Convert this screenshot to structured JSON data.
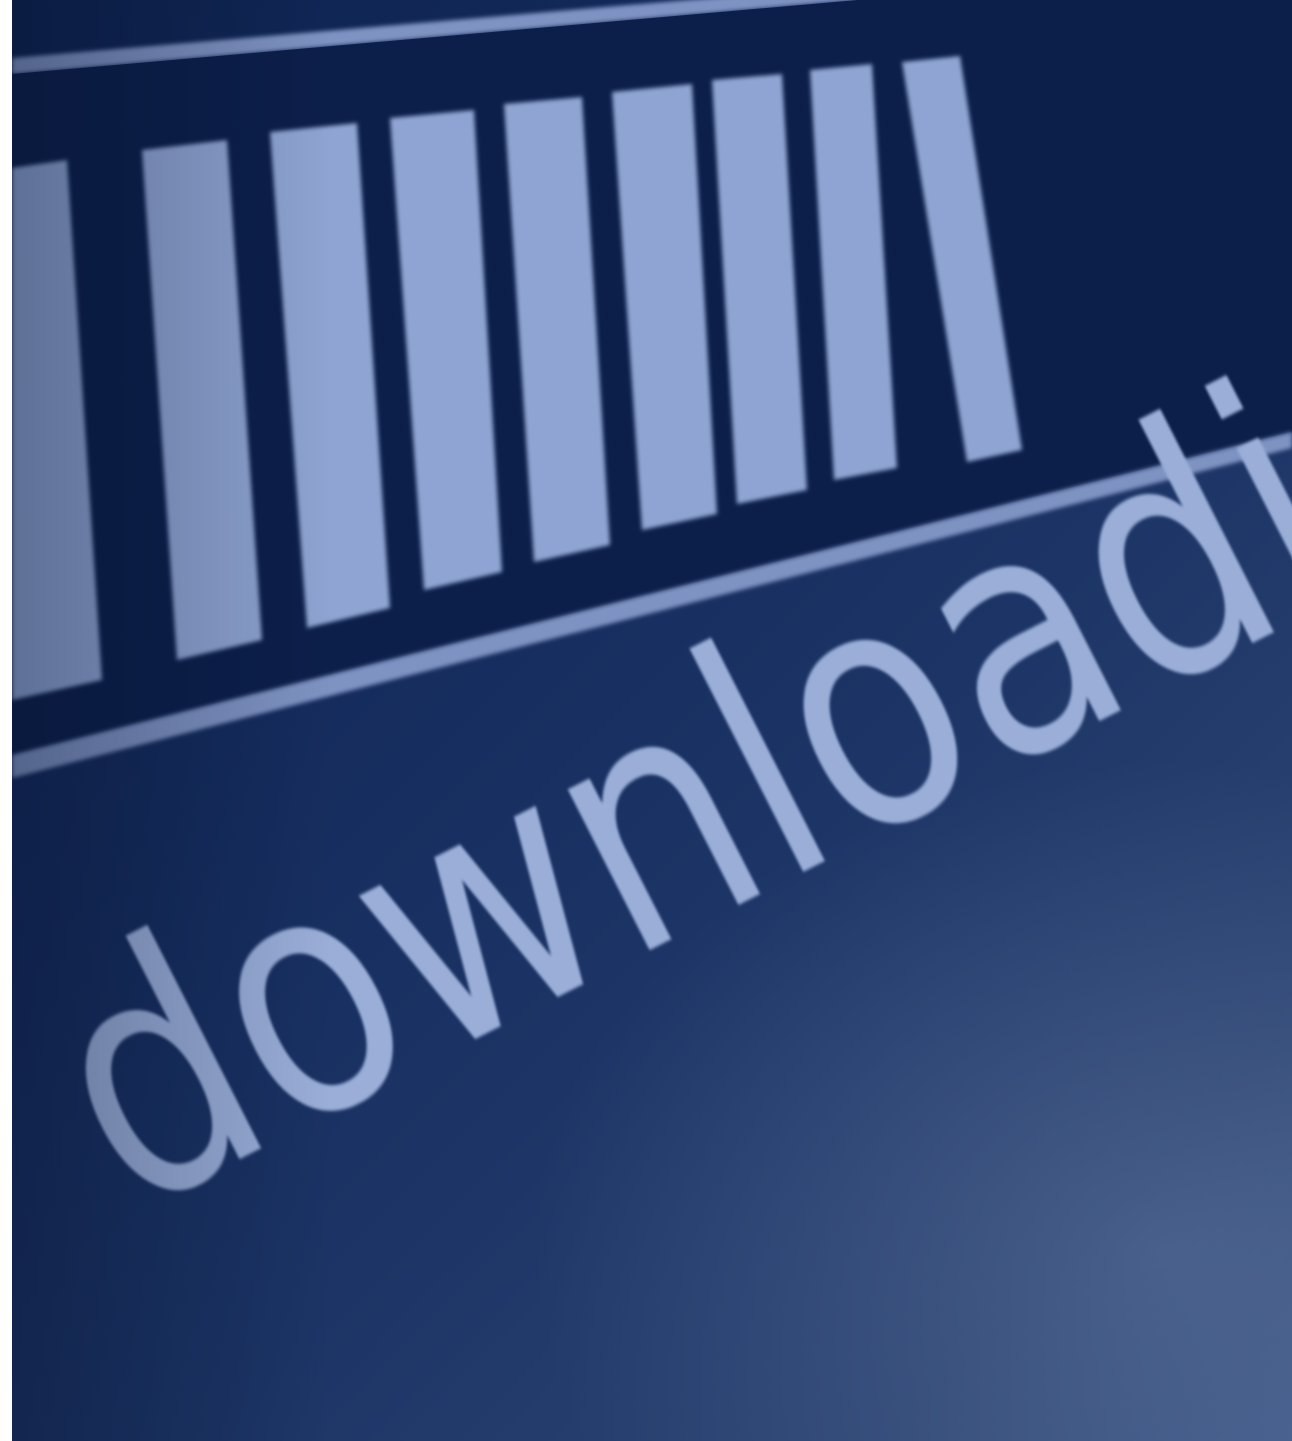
{
  "status": {
    "label": "downloading..."
  },
  "progress": {
    "filled_segments": 9,
    "fraction_visible": 0.8
  },
  "colors": {
    "background": "#142b5c",
    "bar_fill": "#8fa4d2",
    "bar_track": "#0c1f4a",
    "border_line": "#7f93c2",
    "text": "#9aaed8"
  }
}
